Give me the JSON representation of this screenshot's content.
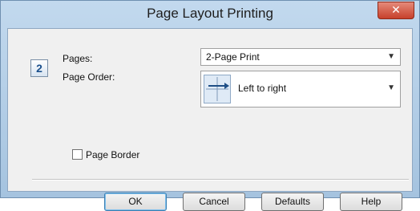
{
  "window": {
    "title": "Page Layout Printing",
    "close_glyph": "✕"
  },
  "main": {
    "layout_badge": "2",
    "pages_label": "Pages:",
    "pages_value": "2-Page Print",
    "page_order_label": "Page Order:",
    "page_order_value": "Left to right",
    "page_order_icon": "left-to-right-icon",
    "page_border_label": "Page Border",
    "page_border_checked": false
  },
  "buttons": {
    "ok": "OK",
    "cancel": "Cancel",
    "defaults": "Defaults",
    "help": "Help"
  },
  "colors": {
    "title_bar": "#a9c6e2",
    "close_button": "#c7402b",
    "dialog_bg": "#f0f0f0"
  }
}
